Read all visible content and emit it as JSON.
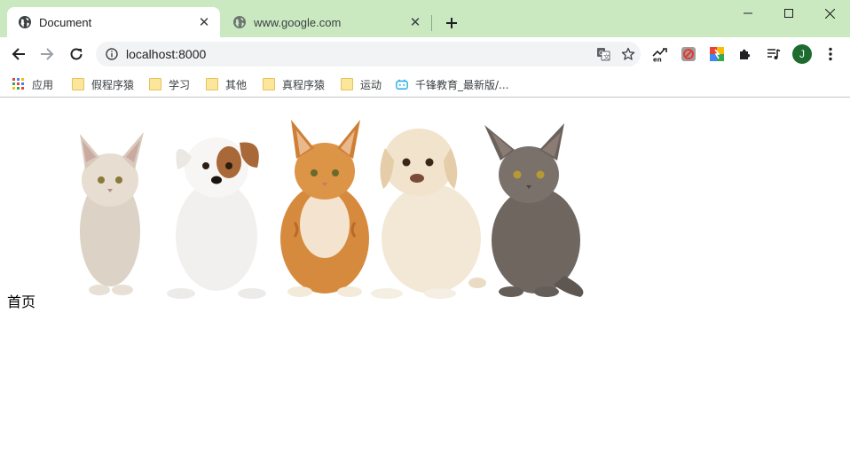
{
  "browser": {
    "tabs": [
      {
        "title": "Document",
        "active": true,
        "favicon": "globe-icon"
      },
      {
        "title": "www.google.com",
        "active": false,
        "favicon": "globe-icon"
      }
    ],
    "address_bar": {
      "url": "localhost:8000"
    },
    "profile_initial": "J",
    "accent": "#cae9c1"
  },
  "bookmarks": [
    {
      "label": "应用",
      "icon": "apps-grid-icon"
    },
    {
      "label": "假程序猿",
      "icon": "folder-icon"
    },
    {
      "label": "学习",
      "icon": "folder-icon"
    },
    {
      "label": "其他",
      "icon": "folder-icon"
    },
    {
      "label": "真程序猿",
      "icon": "folder-icon"
    },
    {
      "label": "运动",
      "icon": "folder-icon"
    },
    {
      "label": "千锋教育_最新版/...",
      "icon": "bilibili-icon"
    }
  ],
  "page": {
    "nav_label": "首页",
    "image": "pets-row-image"
  }
}
